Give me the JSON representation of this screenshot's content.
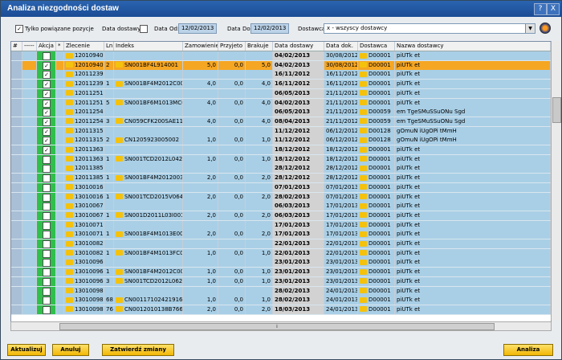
{
  "window": {
    "title": "Analiza niezgodności dostaw",
    "help": "?",
    "close": "X"
  },
  "filters": {
    "only_related_checked": "✓",
    "only_related_label": "Tylko powiązane pozycje",
    "delivery_date_label": "Data dostawy",
    "delivery_date_checked": "",
    "date_from_label": "Data Od:",
    "date_from": "12/02/2013",
    "date_to_label": "Data Do:",
    "date_to": "12/02/2013",
    "supplier_label": "Dostawca:",
    "supplier_value": "x - wszyscy dostawcy"
  },
  "grid": {
    "headers": [
      "#",
      "-----",
      "Akcja",
      "*",
      "Zlecenie",
      "Ln",
      "Indeks",
      "Zamowienie",
      "Przyjeto",
      "Brakuje",
      "Data dostawy",
      "Data dok.",
      "Dostawca",
      "Nazwa dostawcy"
    ],
    "rows": [
      {
        "akcja": "",
        "zlecenie": "12010940",
        "ln": "",
        "indeks": "",
        "zam": "",
        "prz": "",
        "bra": "",
        "dd": "04/02/2013",
        "dok": "30/08/2012",
        "dost": "D00001",
        "nazwa": "piUTk et",
        "bold": true,
        "sel": false
      },
      {
        "akcja": "✓",
        "zlecenie": "12010940",
        "ln": "2",
        "indeks": "SN001BF4L914001",
        "zam": "5,0",
        "prz": "0,0",
        "bra": "5,0",
        "dd": "04/02/2013",
        "dok": "30/08/2012",
        "dost": "D00001",
        "nazwa": "piUTk et",
        "bold": true,
        "sel": true
      },
      {
        "akcja": "✓",
        "zlecenie": "12011239",
        "ln": "",
        "indeks": "",
        "zam": "",
        "prz": "",
        "bra": "",
        "dd": "16/11/2012",
        "dok": "16/11/2012",
        "dost": "D00001",
        "nazwa": "piUTk et",
        "bold": true,
        "sel": false
      },
      {
        "akcja": "✓",
        "zlecenie": "12011239",
        "ln": "1",
        "indeks": "SN001BF4M2012C003",
        "zam": "4,0",
        "prz": "0,0",
        "bra": "4,0",
        "dd": "16/11/2012",
        "dok": "16/11/2012",
        "dost": "D00001",
        "nazwa": "piUTk et",
        "bold": true,
        "sel": false
      },
      {
        "akcja": "✓",
        "zlecenie": "12011251",
        "ln": "",
        "indeks": "",
        "zam": "",
        "prz": "",
        "bra": "",
        "dd": "06/05/2013",
        "dok": "21/11/2012",
        "dost": "D00001",
        "nazwa": "piUTk et",
        "bold": true,
        "sel": false
      },
      {
        "akcja": "✓",
        "zlecenie": "12011251",
        "ln": "5",
        "indeks": "SN001BF6M1013MC002",
        "zam": "4,0",
        "prz": "0,0",
        "bra": "4,0",
        "dd": "04/02/2013",
        "dok": "21/11/2012",
        "dost": "D00001",
        "nazwa": "piUTk et",
        "bold": true,
        "sel": false
      },
      {
        "akcja": "✓",
        "zlecenie": "12011254",
        "ln": "",
        "indeks": "",
        "zam": "",
        "prz": "",
        "bra": "",
        "dd": "06/05/2013",
        "dok": "21/11/2012",
        "dost": "D00059",
        "nazwa": "em TgeSMuSSuONu Sgd",
        "bold": true,
        "sel": false
      },
      {
        "akcja": "✓",
        "zlecenie": "12011254",
        "ln": "3",
        "indeks": "CN059CFK200SAE111654",
        "zam": "4,0",
        "prz": "0,0",
        "bra": "4,0",
        "dd": "08/04/2013",
        "dok": "21/11/2012",
        "dost": "D00059",
        "nazwa": "em TgeSMuSSuONu Sgd",
        "bold": true,
        "sel": false
      },
      {
        "akcja": "✓",
        "zlecenie": "12011315",
        "ln": "",
        "indeks": "",
        "zam": "",
        "prz": "",
        "bra": "",
        "dd": "11/12/2012",
        "dok": "06/12/2012",
        "dost": "D00128",
        "nazwa": "gOmuN iUgOPi tMmH",
        "bold": true,
        "sel": false
      },
      {
        "akcja": "✓",
        "zlecenie": "12011315",
        "ln": "2",
        "indeks": "CN1205923005002",
        "zam": "1,0",
        "prz": "0,0",
        "bra": "1,0",
        "dd": "11/12/2012",
        "dok": "06/12/2012",
        "dost": "D00128",
        "nazwa": "gOmuN iUgOPi tMmH",
        "bold": true,
        "sel": false
      },
      {
        "akcja": "✓",
        "zlecenie": "12011363",
        "ln": "",
        "indeks": "",
        "zam": "",
        "prz": "",
        "bra": "",
        "dd": "18/12/2012",
        "dok": "18/12/2012",
        "dost": "D00001",
        "nazwa": "piUTk et",
        "bold": true,
        "sel": false
      },
      {
        "akcja": "",
        "zlecenie": "12011363",
        "ln": "1",
        "indeks": "SN001TCD2012L042V013",
        "zam": "1,0",
        "prz": "0,0",
        "bra": "1,0",
        "dd": "18/12/2012",
        "dok": "18/12/2012",
        "dost": "D00001",
        "nazwa": "piUTk et",
        "bold": true,
        "sel": false
      },
      {
        "akcja": "",
        "zlecenie": "12011385",
        "ln": "",
        "indeks": "",
        "zam": "",
        "prz": "",
        "bra": "",
        "dd": "28/12/2012",
        "dok": "28/12/2012",
        "dost": "D00001",
        "nazwa": "piUTk et",
        "bold": true,
        "sel": false
      },
      {
        "akcja": "",
        "zlecenie": "12011385",
        "ln": "1",
        "indeks": "SN001BF4M2012003",
        "zam": "2,0",
        "prz": "0,0",
        "bra": "2,0",
        "dd": "28/12/2012",
        "dok": "28/12/2012",
        "dost": "D00001",
        "nazwa": "piUTk et",
        "bold": true,
        "sel": false
      },
      {
        "akcja": "",
        "zlecenie": "13010016",
        "ln": "",
        "indeks": "",
        "zam": "",
        "prz": "",
        "bra": "",
        "dd": "07/01/2013",
        "dok": "07/01/2013",
        "dost": "D00001",
        "nazwa": "piUTk et",
        "bold": true,
        "sel": false
      },
      {
        "akcja": "",
        "zlecenie": "13010016",
        "ln": "1",
        "indeks": "SN001TCD2015V064V001",
        "zam": "2,0",
        "prz": "0,0",
        "bra": "2,0",
        "dd": "28/02/2013",
        "dok": "07/01/2013",
        "dost": "D00001",
        "nazwa": "piUTk et",
        "bold": true,
        "sel": false
      },
      {
        "akcja": "",
        "zlecenie": "13010067",
        "ln": "",
        "indeks": "",
        "zam": "",
        "prz": "",
        "bra": "",
        "dd": "06/03/2013",
        "dok": "17/01/2013",
        "dost": "D00001",
        "nazwa": "piUTk et",
        "bold": true,
        "sel": false
      },
      {
        "akcja": "",
        "zlecenie": "13010067",
        "ln": "1",
        "indeks": "SN001D2011L03I001",
        "zam": "2,0",
        "prz": "0,0",
        "bra": "2,0",
        "dd": "06/03/2013",
        "dok": "17/01/2013",
        "dost": "D00001",
        "nazwa": "piUTk et",
        "bold": true,
        "sel": false
      },
      {
        "akcja": "",
        "zlecenie": "13010071",
        "ln": "",
        "indeks": "",
        "zam": "",
        "prz": "",
        "bra": "",
        "dd": "17/01/2013",
        "dok": "17/01/2013",
        "dost": "D00001",
        "nazwa": "piUTk et",
        "bold": true,
        "sel": false
      },
      {
        "akcja": "",
        "zlecenie": "13010071",
        "ln": "1",
        "indeks": "SN001BF4M1013E001",
        "zam": "2,0",
        "prz": "0,0",
        "bra": "2,0",
        "dd": "17/01/2013",
        "dok": "17/01/2013",
        "dost": "D00001",
        "nazwa": "piUTk et",
        "bold": true,
        "sel": false
      },
      {
        "akcja": "",
        "zlecenie": "13010082",
        "ln": "",
        "indeks": "",
        "zam": "",
        "prz": "",
        "bra": "",
        "dd": "22/01/2013",
        "dok": "22/01/2013",
        "dost": "D00001",
        "nazwa": "piUTk et",
        "bold": true,
        "sel": false
      },
      {
        "akcja": "",
        "zlecenie": "13010082",
        "ln": "1",
        "indeks": "SN001BF4M1013FC003",
        "zam": "1,0",
        "prz": "0,0",
        "bra": "1,0",
        "dd": "22/01/2013",
        "dok": "22/01/2013",
        "dost": "D00001",
        "nazwa": "piUTk et",
        "bold": true,
        "sel": false
      },
      {
        "akcja": "",
        "zlecenie": "13010096",
        "ln": "",
        "indeks": "",
        "zam": "",
        "prz": "",
        "bra": "",
        "dd": "23/01/2013",
        "dok": "23/01/2013",
        "dost": "D00001",
        "nazwa": "piUTk et",
        "bold": true,
        "sel": false
      },
      {
        "akcja": "",
        "zlecenie": "13010096",
        "ln": "1",
        "indeks": "SN001BF4M2012C002",
        "zam": "1,0",
        "prz": "0,0",
        "bra": "1,0",
        "dd": "23/01/2013",
        "dok": "23/01/2013",
        "dost": "D00001",
        "nazwa": "piUTk et",
        "bold": true,
        "sel": false
      },
      {
        "akcja": "",
        "zlecenie": "13010096",
        "ln": "3",
        "indeks": "SN001TCD2012L062V008",
        "zam": "1,0",
        "prz": "0,0",
        "bra": "1,0",
        "dd": "23/01/2013",
        "dok": "23/01/2013",
        "dost": "D00001",
        "nazwa": "piUTk et",
        "bold": true,
        "sel": false
      },
      {
        "akcja": "",
        "zlecenie": "13010098",
        "ln": "",
        "indeks": "",
        "zam": "",
        "prz": "",
        "bra": "",
        "dd": "28/02/2013",
        "dok": "24/01/2013",
        "dost": "D00001",
        "nazwa": "piUTk et",
        "bold": true,
        "sel": false
      },
      {
        "akcja": "",
        "zlecenie": "13010098",
        "ln": "68",
        "indeks": "CN00117102421916",
        "zam": "1,0",
        "prz": "0,0",
        "bra": "1,0",
        "dd": "28/02/2013",
        "dok": "24/01/2013",
        "dost": "D00001",
        "nazwa": "piUTk et",
        "bold": true,
        "sel": false
      },
      {
        "akcja": "",
        "zlecenie": "13010098",
        "ln": "76",
        "indeks": "CN0012010138B766",
        "zam": "2,0",
        "prz": "0,0",
        "bra": "2,0",
        "dd": "18/03/2013",
        "dok": "24/01/2013",
        "dost": "D00001",
        "nazwa": "piUTk et",
        "bold": true,
        "sel": false
      }
    ]
  },
  "buttons": {
    "refresh": "Aktualizuj",
    "cancel": "Anuluj",
    "confirm": "Zatwierdź zmiany",
    "analyze": "Analiza"
  }
}
